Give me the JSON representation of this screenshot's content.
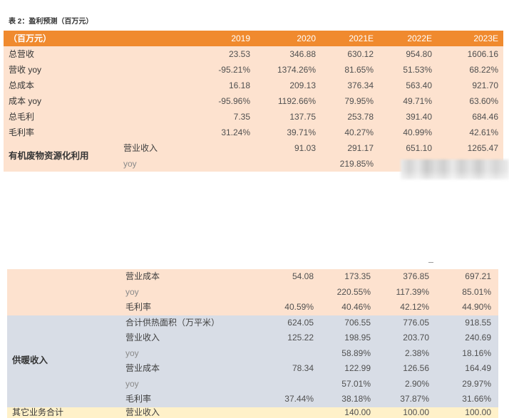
{
  "title": "表 2：盈利预测（百万元）",
  "colors": {
    "header": "#f08a2e",
    "peach": "#fde2cf",
    "gray": "#d8dde6",
    "yellow": "#fff1c9"
  },
  "table1": {
    "header": {
      "unit": "（百万元）",
      "years": [
        "2019",
        "2020",
        "2021E",
        "2022E",
        "2023E"
      ]
    },
    "rows": [
      {
        "label": "总营收",
        "values": [
          "23.53",
          "346.88",
          "630.12",
          "954.80",
          "1606.16"
        ]
      },
      {
        "label": "营收 yoy",
        "values": [
          "-95.21%",
          "1374.26%",
          "81.65%",
          "51.53%",
          "68.22%"
        ]
      },
      {
        "label": "总成本",
        "values": [
          "16.18",
          "209.13",
          "376.34",
          "563.40",
          "921.70"
        ]
      },
      {
        "label": "成本 yoy",
        "values": [
          "-95.96%",
          "1192.66%",
          "79.95%",
          "49.71%",
          "63.60%"
        ]
      },
      {
        "label": "总毛利",
        "values": [
          "7.35",
          "137.75",
          "253.78",
          "391.40",
          "684.46"
        ]
      },
      {
        "label": "毛利率",
        "values": [
          "31.24%",
          "39.71%",
          "40.27%",
          "40.99%",
          "42.61%"
        ]
      }
    ],
    "segment": {
      "name": "有机废物资源化利用",
      "rows": [
        {
          "item": "营业收入",
          "values": [
            "",
            "91.03",
            "291.17",
            "651.10",
            "1265.47"
          ]
        },
        {
          "item": "yoy",
          "values": [
            "",
            "",
            "219.85%",
            "",
            ""
          ]
        }
      ]
    }
  },
  "table2": {
    "continued": {
      "rows": [
        {
          "item": "营业成本",
          "values": [
            "54.08",
            "173.35",
            "376.85",
            "697.21"
          ]
        },
        {
          "item": "yoy",
          "values": [
            "",
            "220.55%",
            "117.39%",
            "85.01%"
          ]
        },
        {
          "item": "毛利率",
          "values": [
            "40.59%",
            "40.46%",
            "42.12%",
            "44.90%"
          ]
        }
      ]
    },
    "heating": {
      "name": "供暖收入",
      "rows": [
        {
          "item": "合计供热面积（万平米）",
          "values": [
            "624.05",
            "706.55",
            "776.05",
            "918.55"
          ]
        },
        {
          "item": "营业收入",
          "values": [
            "125.22",
            "198.95",
            "203.70",
            "240.69"
          ]
        },
        {
          "item": "yoy",
          "values": [
            "",
            "58.89%",
            "2.38%",
            "18.16%"
          ]
        },
        {
          "item": "营业成本",
          "values": [
            "78.34",
            "122.99",
            "126.56",
            "164.49"
          ]
        },
        {
          "item": "yoy",
          "values": [
            "",
            "57.01%",
            "2.90%",
            "29.97%"
          ]
        },
        {
          "item": "毛利率",
          "values": [
            "37.44%",
            "38.18%",
            "37.87%",
            "31.66%"
          ]
        }
      ]
    },
    "other": {
      "name": "其它业务合计",
      "rows": [
        {
          "item": "营业收入",
          "values": [
            "",
            "140.00",
            "100.00",
            "100.00"
          ]
        }
      ]
    }
  }
}
